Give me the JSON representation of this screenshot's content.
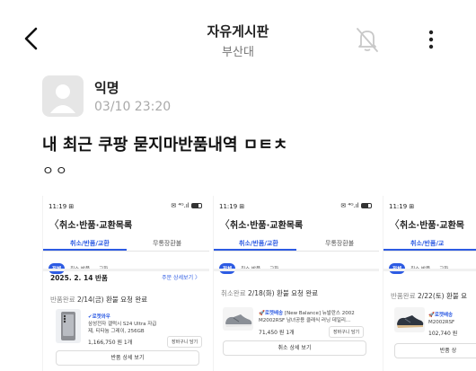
{
  "header": {
    "title": "자유게시판",
    "subtitle": "부산대"
  },
  "post": {
    "author": "익명",
    "datetime": "03/10 23:20",
    "title": "내 최근 쿠팡 묻지마반품내역 ㅁㅌㅊ",
    "body": "ㅇㅇ"
  },
  "screens": [
    {
      "status_time": "11:19 ⊞",
      "status_icons": "✉ ⁴ᴳ.ıl",
      "back": "〈",
      "header": "취소·반품·교환목록",
      "tab_active": "취소/반품/교환",
      "tab_inactive": "무통장환불",
      "chips": [
        "전체",
        "취소·반품",
        "교환"
      ],
      "date": "2025. 2. 14 반품",
      "detail_link": "주문 상세보기 〉",
      "status_prefix": "반품완료 ",
      "status_text": "2/14(금) 환불 요청 완료",
      "brand": "✔로켓와우",
      "name_lines": [
        "삼성전자 갤럭시 S24 Ultra 자급",
        "제, 티타늄 그레이, 256GB"
      ],
      "price": "1,166,750 원   1개",
      "cart": "장바구니 담기",
      "big_button": "반품 상세 보기"
    },
    {
      "status_time": "11:19 ⊞",
      "status_icons": "✉ ⁴ᴳ.ıl",
      "back": "〈",
      "header": "취소·반품·교환목록",
      "tab_active": "취소/반품/교환",
      "tab_inactive": "무통장환불",
      "chips": [
        "전체",
        "취소·반품",
        "교환"
      ],
      "status_prefix": "취소완료 ",
      "status_text": "2/18(화) 환불 요청 완료",
      "brand": "🚀로켓배송",
      "name_lines": [
        "[New Balance] 뉴발란스 2002",
        "M2002RSF 남녀공용 클래식 러닝 데일리..."
      ],
      "price": "71,450 원   1개",
      "cart": "장바구니 담기",
      "big_button": "취소 상세 보기"
    },
    {
      "status_time": "11:19 ⊞",
      "back": "〈",
      "header": "취소·반품·교환목",
      "tab_active": "취소/반품/교",
      "chips": [
        "전체",
        "취소·반품",
        "교환"
      ],
      "status_prefix": "반품완료 ",
      "status_text": "2/22(토) 환불 요",
      "brand": "🚀로켓배송",
      "name_lines": [
        "M2002RSF"
      ],
      "price": "102,740 원",
      "big_button": "반품 상"
    }
  ]
}
